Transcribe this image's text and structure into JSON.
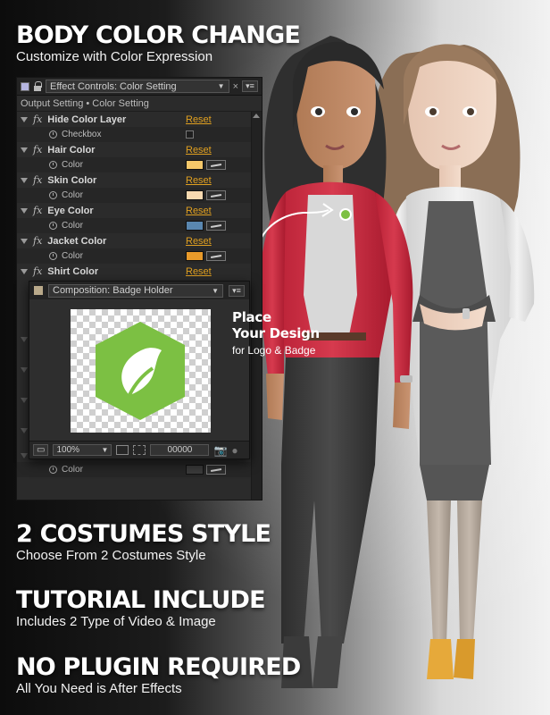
{
  "hero": {
    "title": "BODY COLOR CHANGE",
    "subtitle": "Customize with Color Expression"
  },
  "effect_controls": {
    "tab_label": "Effect Controls: Color Setting",
    "breadcrumb": "Output Setting • Color Setting",
    "effects": [
      {
        "name": "Hide Color Layer",
        "reset": "Reset",
        "prop": "Checkbox",
        "type": "checkbox"
      },
      {
        "name": "Hair Color",
        "reset": "Reset",
        "prop": "Color",
        "type": "color",
        "color": "#f5c86a"
      },
      {
        "name": "Skin Color",
        "reset": "Reset",
        "prop": "Color",
        "type": "color",
        "color": "#f8d9b0"
      },
      {
        "name": "Eye Color",
        "reset": "Reset",
        "prop": "Color",
        "type": "color",
        "color": "#5a87b0"
      },
      {
        "name": "Jacket Color",
        "reset": "Reset",
        "prop": "Color",
        "type": "color",
        "color": "#e89a2a"
      },
      {
        "name": "Shirt Color",
        "reset": "Reset"
      }
    ],
    "bottom_prop": "Color",
    "bottom_color": "#3a3a3a"
  },
  "composition": {
    "tab_label": "Composition: Badge Holder",
    "zoom": "100%",
    "timecode": "00000",
    "logo_color": "#7cc043"
  },
  "place": {
    "line1": "Place",
    "line2": "Your Design",
    "caption": "for Logo & Badge"
  },
  "features": [
    {
      "title": "2 COSTUMES STYLE",
      "subtitle": "Choose From 2 Costumes Style"
    },
    {
      "title": "TUTORIAL INCLUDE",
      "subtitle": "Includes 2 Type of Video & Image"
    },
    {
      "title": "NO PLUGIN REQUIRED",
      "subtitle": "All You Need is After Effects"
    }
  ],
  "colors": {
    "jacket_red": "#d63a4e",
    "jacket_white": "#e9e9e9",
    "dress_grey": "#5a5a5a",
    "accent_orange": "#e0a020"
  }
}
